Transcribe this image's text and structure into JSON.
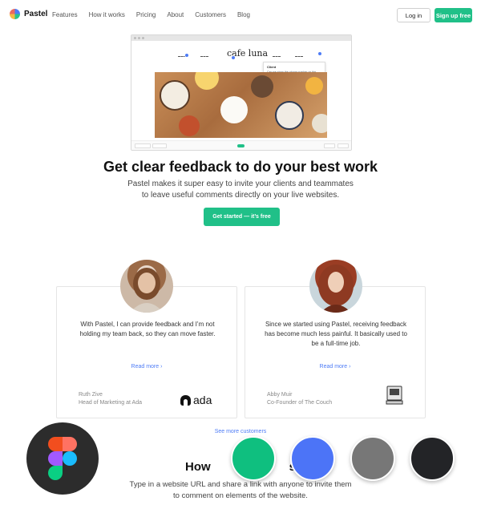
{
  "nav": {
    "brand": "Pastel",
    "links": [
      "Features",
      "How it works",
      "Pricing",
      "About",
      "Customers",
      "Blog"
    ],
    "login_label": "Log in",
    "signup_label": "Sign up free",
    "accent_color": "#20c088"
  },
  "mockup": {
    "brand": "cafe luna",
    "comment_author": "Client",
    "comment_text": "Can we show the phone number on the navigation bar?"
  },
  "hero": {
    "title": "Get clear feedback to do your best work",
    "subtitle_line1": "Pastel makes it super easy to invite your clients and teammates",
    "subtitle_line2": "to leave useful comments directly on your live websites.",
    "cta_label": "Get started — it’s free"
  },
  "testimonials": [
    {
      "quote": "With Pastel, I can provide feedback and I’m not holding my team back, so they can move faster.",
      "read_more": "Read more",
      "name": "Ruth Zive",
      "role": "Head of Marketing at Ada",
      "company_logo": "ada"
    },
    {
      "quote": "Since we started using Pastel, receiving feedback has become much less painful. It basically used to be a full-time job.",
      "read_more": "Read more",
      "name": "Abby Muir",
      "role": "Co-Founder of The Couch",
      "company_logo": "computer-icon"
    }
  ],
  "see_more_label": "See more customers",
  "how": {
    "title_left": "How",
    "title_right": "s",
    "subtitle_line1": "Type in a website URL and share a link with anyone to invite them",
    "subtitle_line2": "to comment on elements of the website."
  },
  "overlay": {
    "figma_icon": "figma-icon",
    "swatches": [
      "#0fbf7f",
      "#4c74f7",
      "#777777",
      "#232427"
    ]
  }
}
